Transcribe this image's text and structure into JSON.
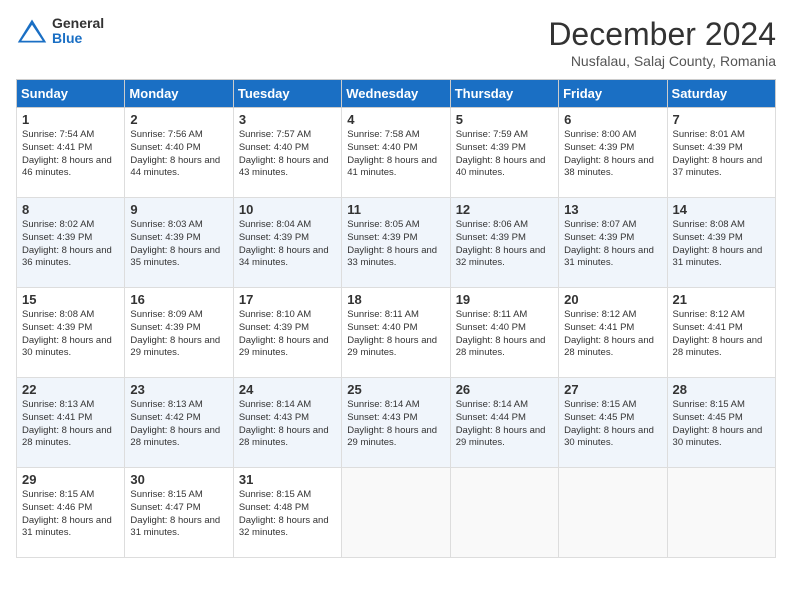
{
  "header": {
    "logo_general": "General",
    "logo_blue": "Blue",
    "month_title": "December 2024",
    "location": "Nusfalau, Salaj County, Romania"
  },
  "days_of_week": [
    "Sunday",
    "Monday",
    "Tuesday",
    "Wednesday",
    "Thursday",
    "Friday",
    "Saturday"
  ],
  "weeks": [
    [
      {
        "day": "1",
        "sunrise": "Sunrise: 7:54 AM",
        "sunset": "Sunset: 4:41 PM",
        "daylight": "Daylight: 8 hours and 46 minutes."
      },
      {
        "day": "2",
        "sunrise": "Sunrise: 7:56 AM",
        "sunset": "Sunset: 4:40 PM",
        "daylight": "Daylight: 8 hours and 44 minutes."
      },
      {
        "day": "3",
        "sunrise": "Sunrise: 7:57 AM",
        "sunset": "Sunset: 4:40 PM",
        "daylight": "Daylight: 8 hours and 43 minutes."
      },
      {
        "day": "4",
        "sunrise": "Sunrise: 7:58 AM",
        "sunset": "Sunset: 4:40 PM",
        "daylight": "Daylight: 8 hours and 41 minutes."
      },
      {
        "day": "5",
        "sunrise": "Sunrise: 7:59 AM",
        "sunset": "Sunset: 4:39 PM",
        "daylight": "Daylight: 8 hours and 40 minutes."
      },
      {
        "day": "6",
        "sunrise": "Sunrise: 8:00 AM",
        "sunset": "Sunset: 4:39 PM",
        "daylight": "Daylight: 8 hours and 38 minutes."
      },
      {
        "day": "7",
        "sunrise": "Sunrise: 8:01 AM",
        "sunset": "Sunset: 4:39 PM",
        "daylight": "Daylight: 8 hours and 37 minutes."
      }
    ],
    [
      {
        "day": "8",
        "sunrise": "Sunrise: 8:02 AM",
        "sunset": "Sunset: 4:39 PM",
        "daylight": "Daylight: 8 hours and 36 minutes."
      },
      {
        "day": "9",
        "sunrise": "Sunrise: 8:03 AM",
        "sunset": "Sunset: 4:39 PM",
        "daylight": "Daylight: 8 hours and 35 minutes."
      },
      {
        "day": "10",
        "sunrise": "Sunrise: 8:04 AM",
        "sunset": "Sunset: 4:39 PM",
        "daylight": "Daylight: 8 hours and 34 minutes."
      },
      {
        "day": "11",
        "sunrise": "Sunrise: 8:05 AM",
        "sunset": "Sunset: 4:39 PM",
        "daylight": "Daylight: 8 hours and 33 minutes."
      },
      {
        "day": "12",
        "sunrise": "Sunrise: 8:06 AM",
        "sunset": "Sunset: 4:39 PM",
        "daylight": "Daylight: 8 hours and 32 minutes."
      },
      {
        "day": "13",
        "sunrise": "Sunrise: 8:07 AM",
        "sunset": "Sunset: 4:39 PM",
        "daylight": "Daylight: 8 hours and 31 minutes."
      },
      {
        "day": "14",
        "sunrise": "Sunrise: 8:08 AM",
        "sunset": "Sunset: 4:39 PM",
        "daylight": "Daylight: 8 hours and 31 minutes."
      }
    ],
    [
      {
        "day": "15",
        "sunrise": "Sunrise: 8:08 AM",
        "sunset": "Sunset: 4:39 PM",
        "daylight": "Daylight: 8 hours and 30 minutes."
      },
      {
        "day": "16",
        "sunrise": "Sunrise: 8:09 AM",
        "sunset": "Sunset: 4:39 PM",
        "daylight": "Daylight: 8 hours and 29 minutes."
      },
      {
        "day": "17",
        "sunrise": "Sunrise: 8:10 AM",
        "sunset": "Sunset: 4:39 PM",
        "daylight": "Daylight: 8 hours and 29 minutes."
      },
      {
        "day": "18",
        "sunrise": "Sunrise: 8:11 AM",
        "sunset": "Sunset: 4:40 PM",
        "daylight": "Daylight: 8 hours and 29 minutes."
      },
      {
        "day": "19",
        "sunrise": "Sunrise: 8:11 AM",
        "sunset": "Sunset: 4:40 PM",
        "daylight": "Daylight: 8 hours and 28 minutes."
      },
      {
        "day": "20",
        "sunrise": "Sunrise: 8:12 AM",
        "sunset": "Sunset: 4:41 PM",
        "daylight": "Daylight: 8 hours and 28 minutes."
      },
      {
        "day": "21",
        "sunrise": "Sunrise: 8:12 AM",
        "sunset": "Sunset: 4:41 PM",
        "daylight": "Daylight: 8 hours and 28 minutes."
      }
    ],
    [
      {
        "day": "22",
        "sunrise": "Sunrise: 8:13 AM",
        "sunset": "Sunset: 4:41 PM",
        "daylight": "Daylight: 8 hours and 28 minutes."
      },
      {
        "day": "23",
        "sunrise": "Sunrise: 8:13 AM",
        "sunset": "Sunset: 4:42 PM",
        "daylight": "Daylight: 8 hours and 28 minutes."
      },
      {
        "day": "24",
        "sunrise": "Sunrise: 8:14 AM",
        "sunset": "Sunset: 4:43 PM",
        "daylight": "Daylight: 8 hours and 28 minutes."
      },
      {
        "day": "25",
        "sunrise": "Sunrise: 8:14 AM",
        "sunset": "Sunset: 4:43 PM",
        "daylight": "Daylight: 8 hours and 29 minutes."
      },
      {
        "day": "26",
        "sunrise": "Sunrise: 8:14 AM",
        "sunset": "Sunset: 4:44 PM",
        "daylight": "Daylight: 8 hours and 29 minutes."
      },
      {
        "day": "27",
        "sunrise": "Sunrise: 8:15 AM",
        "sunset": "Sunset: 4:45 PM",
        "daylight": "Daylight: 8 hours and 30 minutes."
      },
      {
        "day": "28",
        "sunrise": "Sunrise: 8:15 AM",
        "sunset": "Sunset: 4:45 PM",
        "daylight": "Daylight: 8 hours and 30 minutes."
      }
    ],
    [
      {
        "day": "29",
        "sunrise": "Sunrise: 8:15 AM",
        "sunset": "Sunset: 4:46 PM",
        "daylight": "Daylight: 8 hours and 31 minutes."
      },
      {
        "day": "30",
        "sunrise": "Sunrise: 8:15 AM",
        "sunset": "Sunset: 4:47 PM",
        "daylight": "Daylight: 8 hours and 31 minutes."
      },
      {
        "day": "31",
        "sunrise": "Sunrise: 8:15 AM",
        "sunset": "Sunset: 4:48 PM",
        "daylight": "Daylight: 8 hours and 32 minutes."
      },
      null,
      null,
      null,
      null
    ]
  ]
}
